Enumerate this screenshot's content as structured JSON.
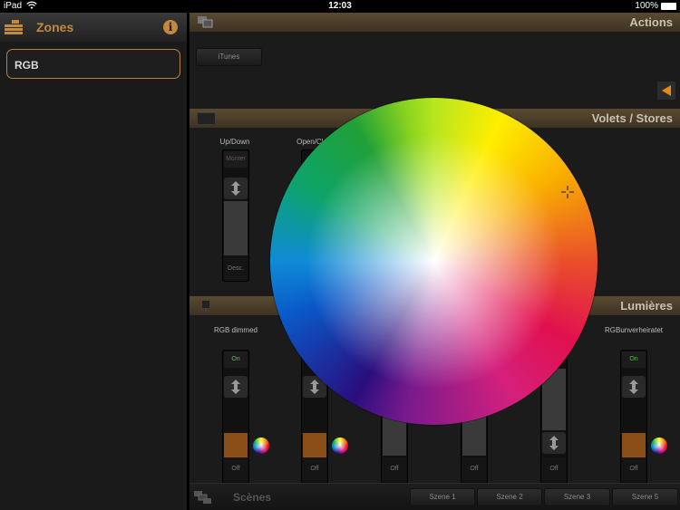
{
  "status_bar": {
    "carrier": "iPad",
    "time": "12:03",
    "battery": "100%"
  },
  "zones": {
    "title": "Zones",
    "items": [
      {
        "label": "RGB"
      }
    ]
  },
  "actions": {
    "title": "Actions",
    "buttons": [
      {
        "label": "iTunes"
      }
    ]
  },
  "volets": {
    "title": "Volets / Stores",
    "columns": [
      {
        "label": "Up/Down",
        "top": "Monter",
        "bottom": "Desc."
      },
      {
        "label": "Open/Clo"
      }
    ]
  },
  "lumieres": {
    "title": "Lumières",
    "columns": [
      {
        "label": "RGB dimmed",
        "top": "On",
        "bottom": "Off",
        "level": 0.58
      },
      {
        "label": "",
        "top": "",
        "bottom": "Off",
        "level": 0.58
      },
      {
        "label": "",
        "top": "",
        "bottom": "Off",
        "level": 0.0
      },
      {
        "label": "",
        "top": "",
        "bottom": "Off",
        "level": 0.0
      },
      {
        "label": "",
        "top": "",
        "bottom": "Off",
        "level": 0.0
      },
      {
        "label": "RGBunverheiratet",
        "top": "On",
        "bottom": "Off",
        "level": 0.58
      }
    ]
  },
  "scenes": {
    "title": "Scènes",
    "buttons": [
      "Szene 1",
      "Szene 2",
      "Szene 3",
      "Szene 5"
    ]
  },
  "colors": {
    "accent": "#c4893b",
    "section_bar": "#4a3c29",
    "fill_orange": "#8a4f18"
  }
}
